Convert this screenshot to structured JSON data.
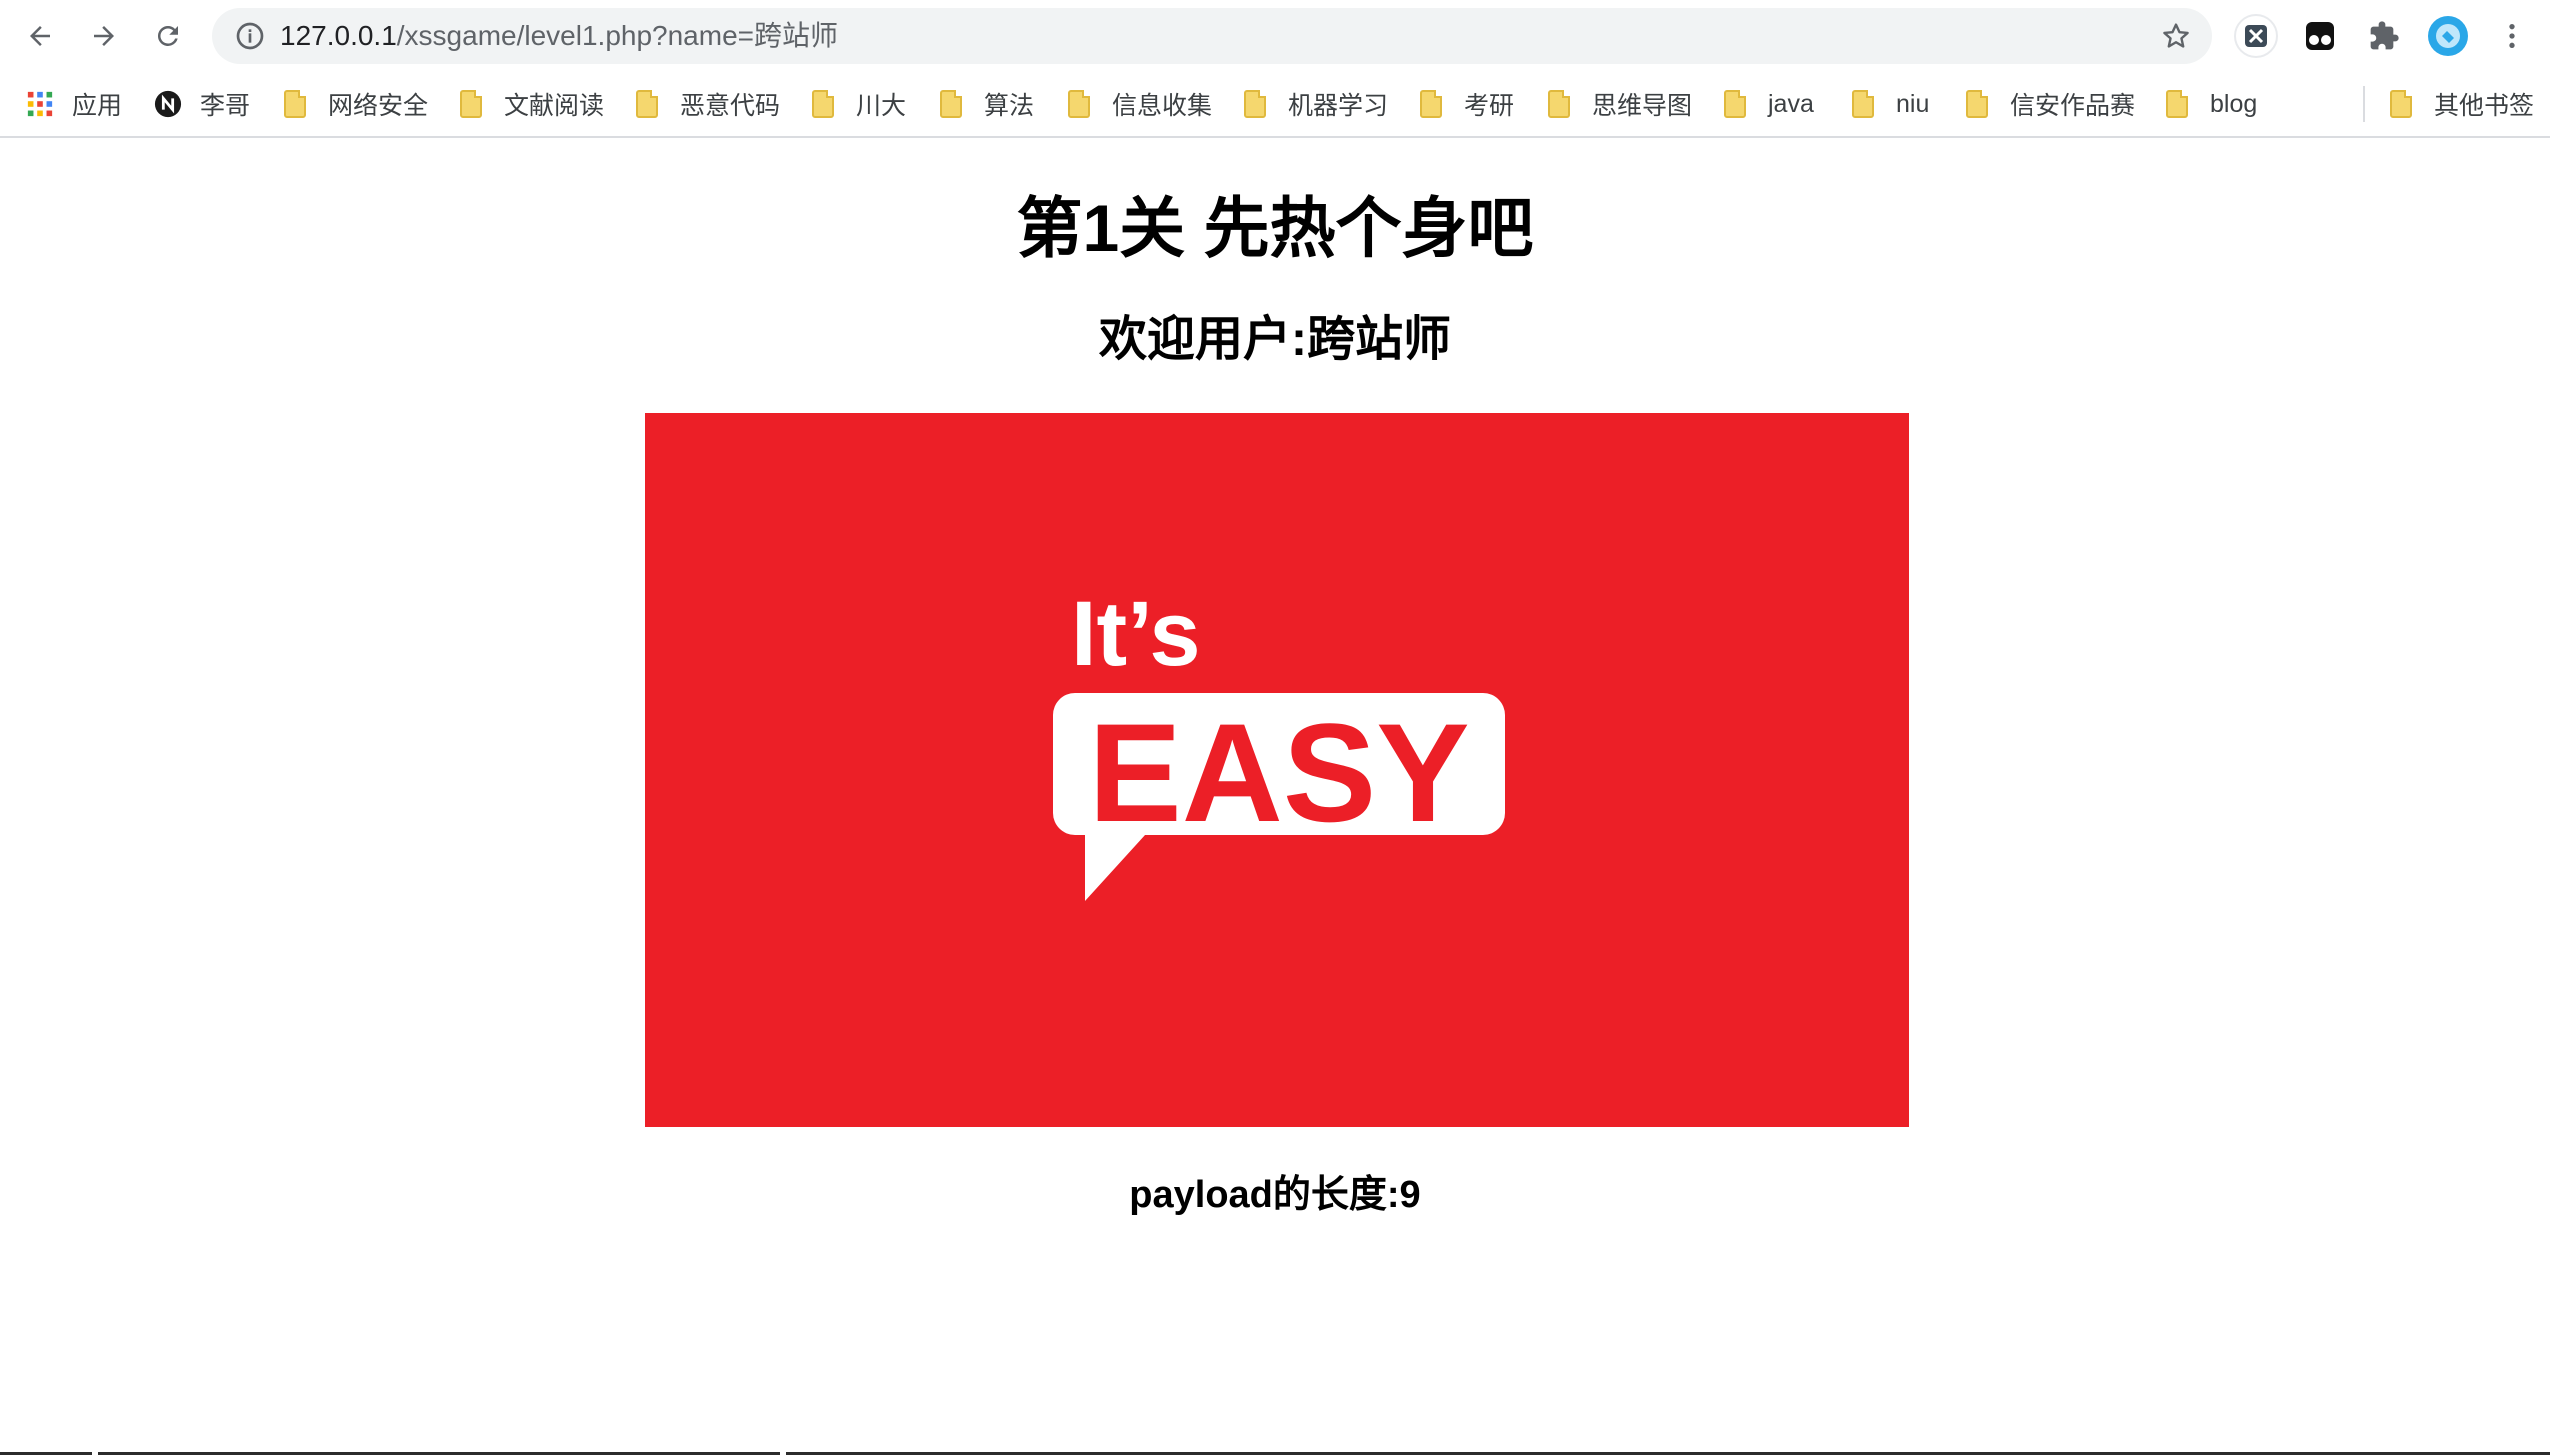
{
  "browser": {
    "url_host": "127.0.0.1",
    "url_path": "/xssgame/level1.php?name=跨站师",
    "bookmarks": [
      {
        "label": "应用",
        "icon": "apps-icon"
      },
      {
        "label": "李哥",
        "icon": "notion-icon"
      },
      {
        "label": "网络安全",
        "icon": "folder-icon"
      },
      {
        "label": "文献阅读",
        "icon": "folder-icon"
      },
      {
        "label": "恶意代码",
        "icon": "folder-icon"
      },
      {
        "label": "川大",
        "icon": "folder-icon"
      },
      {
        "label": "算法",
        "icon": "folder-icon"
      },
      {
        "label": "信息收集",
        "icon": "folder-icon"
      },
      {
        "label": "机器学习",
        "icon": "folder-icon"
      },
      {
        "label": "考研",
        "icon": "folder-icon"
      },
      {
        "label": "思维导图",
        "icon": "folder-icon"
      },
      {
        "label": "java",
        "icon": "folder-icon"
      },
      {
        "label": "niu",
        "icon": "folder-icon"
      },
      {
        "label": "信安作品赛",
        "icon": "folder-icon"
      },
      {
        "label": "blog",
        "icon": "folder-icon"
      }
    ],
    "other_bookmarks": "其他书签"
  },
  "page": {
    "title": "第1关 先热个身吧",
    "welcome": "欢迎用户:跨站师",
    "hero_line1": "It’s",
    "hero_line2": "EASY",
    "payload_length": "payload的长度:9"
  },
  "colors": {
    "hero_bg": "#ec1f27",
    "omnibox_bg": "#f1f3f4"
  }
}
